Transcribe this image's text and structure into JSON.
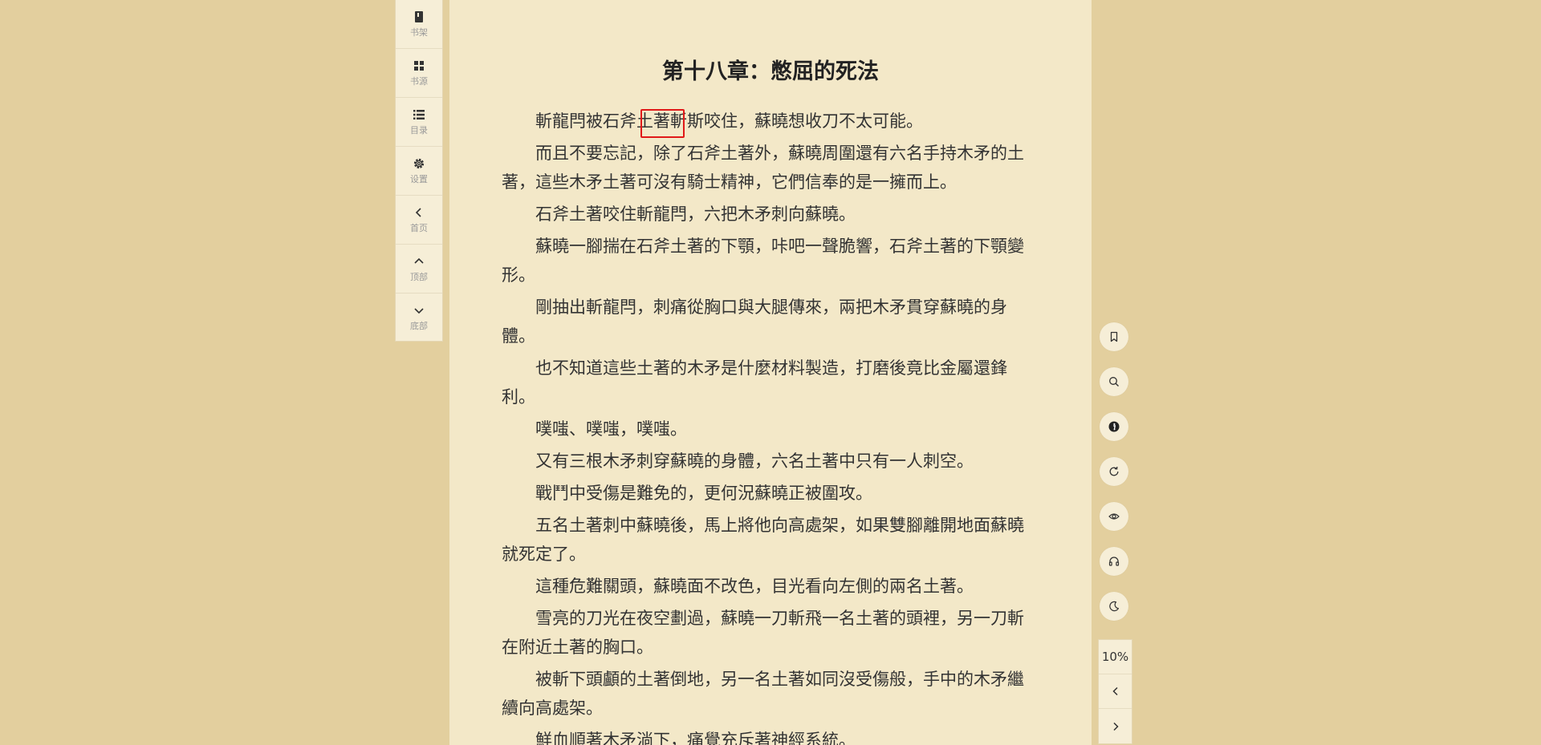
{
  "left_toolbar": {
    "items": [
      {
        "label": "书架",
        "icon": "bookshelf-icon"
      },
      {
        "label": "书源",
        "icon": "grid-icon"
      },
      {
        "label": "目录",
        "icon": "list-icon"
      },
      {
        "label": "设置",
        "icon": "gear-icon"
      },
      {
        "label": "首页",
        "icon": "chevron-left-icon"
      },
      {
        "label": "顶部",
        "icon": "chevron-up-icon"
      },
      {
        "label": "底部",
        "icon": "chevron-down-icon"
      }
    ]
  },
  "chapter": {
    "title": "第十八章：憋屈的死法",
    "paragraphs": [
      "斬龍閂被石斧土著斬斯咬住，蘇曉想收刀不太可能。",
      "而且不要忘記，除了石斧土著外，蘇曉周圍還有六名手持木矛的土著，這些木矛土著可沒有騎士精神，它們信奉的是一擁而上。",
      "石斧土著咬住斬龍閂，六把木矛刺向蘇曉。",
      "蘇曉一腳揣在石斧土著的下顎，咔吧一聲脆響，石斧土著的下顎變形。",
      "剛抽出斬龍閂，刺痛從胸口與大腿傳來，兩把木矛貫穿蘇曉的身體。",
      "也不知道這些土著的木矛是什麼材料製造，打磨後竟比金屬還鋒利。",
      "噗嗤、噗嗤，噗嗤。",
      "又有三根木矛刺穿蘇曉的身體，六名土著中只有一人刺空。",
      "戰鬥中受傷是難免的，更何況蘇曉正被圍攻。",
      "五名土著刺中蘇曉後，馬上將他向高處架，如果雙腳離開地面蘇曉就死定了。",
      "這種危難關頭，蘇曉面不改色，目光看向左側的兩名土著。",
      "雪亮的刀光在夜空劃過，蘇曉一刀斬飛一名土著的頭裡，另一刀斬在附近土著的胸口。",
      "被斬下頭顱的土著倒地，另一名土著如同沒受傷般，手中的木矛繼續向高處架。",
      "鮮血順著木矛淌下，痛覺充斥著神經系統。"
    ]
  },
  "right_tools": {
    "buttons": [
      "bookmark-icon",
      "search-icon",
      "info-icon",
      "refresh-icon",
      "eye-icon",
      "headphones-icon",
      "moon-icon"
    ]
  },
  "progress": {
    "percent": "10%"
  },
  "colors": {
    "background": "#e3cf9e",
    "page": "#f3e8c8",
    "highlight": "#e01919"
  }
}
